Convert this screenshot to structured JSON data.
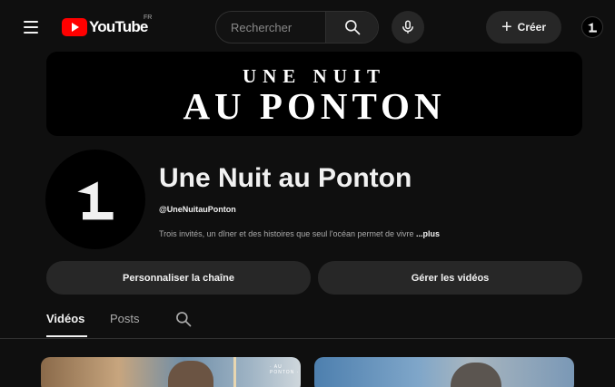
{
  "header": {
    "logo_text": "YouTube",
    "country_code": "FR",
    "search_placeholder": "Rechercher",
    "create_label": "Créer"
  },
  "banner": {
    "line1": "UNE NUIT",
    "line2": "AU PONTON"
  },
  "channel": {
    "name": "Une Nuit au Ponton",
    "handle": "@UneNuitauPonton",
    "description": "Trois invités, un dîner et des histoires que seul l'océan permet de vivre",
    "more_label": "...plus"
  },
  "actions": {
    "customize_label": "Personnaliser la chaîne",
    "manage_label": "Gérer les vidéos"
  },
  "tabs": [
    {
      "label": "Vidéos",
      "active": true
    },
    {
      "label": "Posts",
      "active": false
    }
  ],
  "thumbnails": [
    {
      "watermark": "· AU PONTON ·"
    },
    {
      "watermark": ""
    }
  ],
  "colors": {
    "background": "#0f0f0f",
    "button_bg": "#272727",
    "brand_red": "#ff0000",
    "text_primary": "#f1f1f1",
    "text_secondary": "#aaaaaa"
  }
}
